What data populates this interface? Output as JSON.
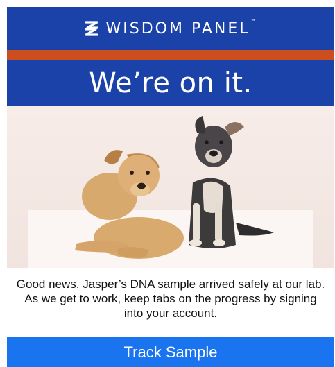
{
  "brand": {
    "name": "WISDOM PANEL",
    "trademark": "™",
    "logo_icon": "wisdom-panel-mark-icon"
  },
  "colors": {
    "brand_blue": "#1a42a8",
    "accent_orange": "#cc4e1f",
    "button_blue": "#1a74ef"
  },
  "headline": "We’re on it.",
  "hero_image": {
    "subject": "two-puppies-photo"
  },
  "message": "Good news. Jasper’s DNA sample arrived safely at our lab. As we get to work, keep tabs on the progress by signing into your account.",
  "cta": {
    "label": "Track Sample"
  }
}
